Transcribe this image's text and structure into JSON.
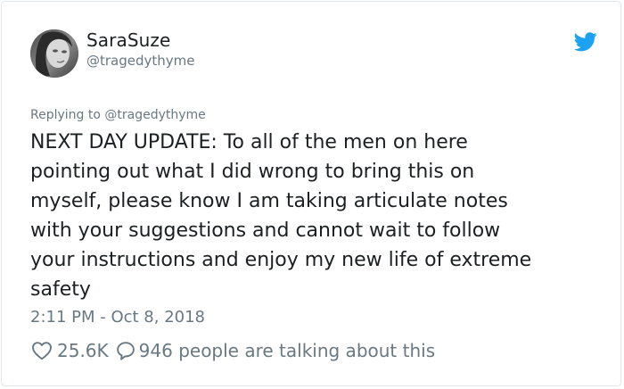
{
  "author": {
    "name": "SaraSuze",
    "handle": "@tragedythyme"
  },
  "reply_context": "Replying to @tragedythyme",
  "tweet": {
    "text": "NEXT DAY UPDATE: To all of the men on here\npointing out what I did wrong to bring this on\nmyself, please know I am taking articulate notes\nwith your suggestions and cannot wait to follow\nyour instructions and enjoy my new life of extreme\nsafety",
    "timestamp": "2:11 PM - Oct 8, 2018"
  },
  "stats": {
    "likes": "25.6K",
    "talking": "946 people are talking about this"
  },
  "colors": {
    "text": "#1c2022",
    "muted": "#697882",
    "brand": "#1da1f2",
    "border": "#e1e8ed"
  },
  "icons": {
    "brand": "twitter-bird-icon",
    "like": "heart-icon",
    "reply": "speech-bubble-icon"
  }
}
